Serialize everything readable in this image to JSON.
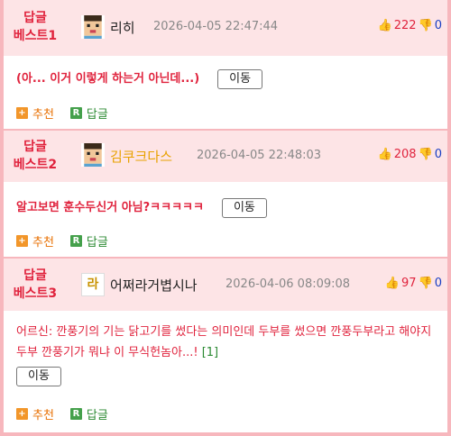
{
  "comments": [
    {
      "badge_line1": "답글",
      "badge_line2": "베스트1",
      "avatar": "pixel-face-icon",
      "nickname": "리히",
      "datetime": "2026-04-05 22:47:44",
      "upvotes": "222",
      "downvotes": "0",
      "text": "(아... 이거 이렇게 하는거 아닌데...)",
      "move_label": "이동",
      "recommend_label": "추천",
      "reply_label": "답글"
    },
    {
      "badge_line1": "답글",
      "badge_line2": "베스트2",
      "avatar": "pixel-face-icon",
      "nickname": "김쿠크다스",
      "datetime": "2026-04-05 22:48:03",
      "upvotes": "208",
      "downvotes": "0",
      "text": "알고보면 훈수두신거 아님?ㅋㅋㅋㅋㅋ",
      "move_label": "이동",
      "recommend_label": "추천",
      "reply_label": "답글"
    },
    {
      "badge_line1": "답글",
      "badge_line2": "베스트3",
      "avatar": "level-badge-icon",
      "avatar_text": "라",
      "nickname": "어쩌라거볍시나",
      "datetime": "2026-04-06 08:09:08",
      "upvotes": "97",
      "downvotes": "0",
      "text": "어르신: 깐풍기의 기는 닭고기를 썼다는 의미인데 두부를 썼으면 깐풍두부라고 해야지 두부 깐풍기가 뭐냐 이 무식헌놈아...!",
      "ref_link": "[1]",
      "move_label": "이동",
      "recommend_label": "추천",
      "reply_label": "답글"
    }
  ],
  "colors": {
    "badge": "#e0233d",
    "header_bg": "#fde4e6",
    "border": "#f7b7bd",
    "upvote": "#e0233d",
    "downvote": "#1a3fc4",
    "gold_nick": "#e8a200"
  }
}
